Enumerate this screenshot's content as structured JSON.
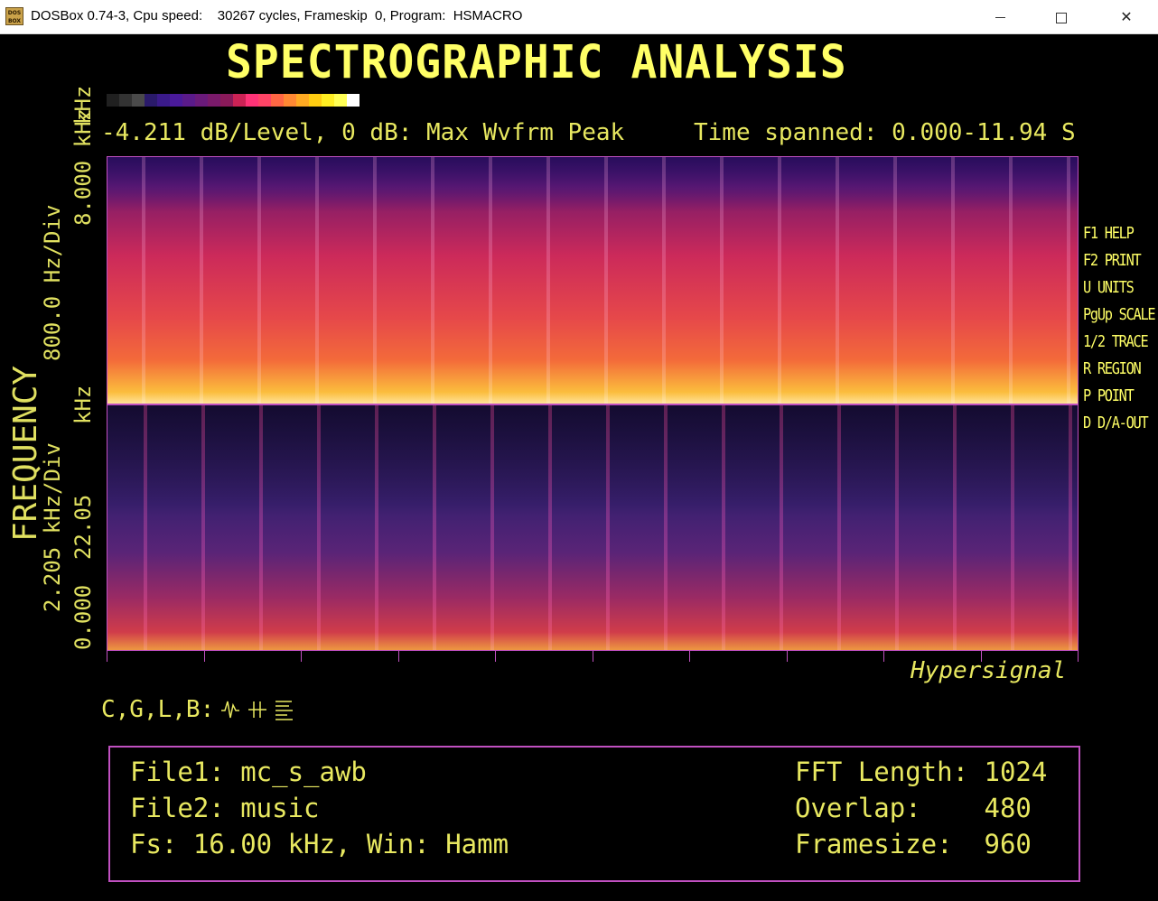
{
  "window": {
    "title": "DOSBox 0.74-3, Cpu speed:    30267 cycles, Frameskip  0, Program:  HSMACRO",
    "minimize_glyph": "",
    "maximize_glyph": "",
    "close_glyph": "✕",
    "app_icon_text": "DOS BOX"
  },
  "app": {
    "heading": "SPECTROGRAPHIC ANALYSIS",
    "header_left": "-4.211 dB/Level, 0 dB: Max Wvfrm Peak",
    "header_right": "Time spanned: 0.000-11.94 S",
    "color_scale": [
      "#202020",
      "#333333",
      "#4a4a4a",
      "#2a1a6a",
      "#3a1a8a",
      "#4a1a9a",
      "#5a1a8a",
      "#6a1a7a",
      "#7a1a6a",
      "#8a1a5a",
      "#cc2255",
      "#ff3377",
      "#ff4466",
      "#ff6644",
      "#ff8833",
      "#ffaa22",
      "#ffcc11",
      "#ffee22",
      "#ffff55",
      "#ffffff"
    ],
    "y_axis": {
      "main_label": "FREQUENCY",
      "top_pane_min": "8.000 kHz",
      "top_pane_div": "800.0 Hz/Div",
      "top_pane_base": "kHz",
      "top_pane_tick": "8",
      "bottom_pane_max": "22.05",
      "bottom_pane_div": "2.205 kHz/Div",
      "bottom_pane_min": "0.000",
      "bottom_pane_zero": "0"
    },
    "brand": "Hypersignal",
    "menu": [
      "F1 HELP",
      "F2 PRINT",
      "U UNITS",
      "PgUp SCALE",
      "1/2 TRACE",
      "R REGION",
      "P POINT",
      "D D/A-OUT"
    ],
    "tools_label": "C,G,L,B:",
    "tool_icons": [
      "waveform-icon",
      "cursor-ticks-icon",
      "bars-icon"
    ],
    "info": {
      "file1": "File1: mc_s_awb",
      "file2": "File2: music",
      "fs": "Fs: 16.00 kHz, Win: Hamm",
      "fft": "FFT Length: 1024",
      "overlap": "Overlap:    480",
      "framesize": "Framesize:  960"
    }
  },
  "colors": {
    "text_yellow": "#ffff55",
    "frame_magenta": "#c050c0",
    "background": "#000000"
  }
}
